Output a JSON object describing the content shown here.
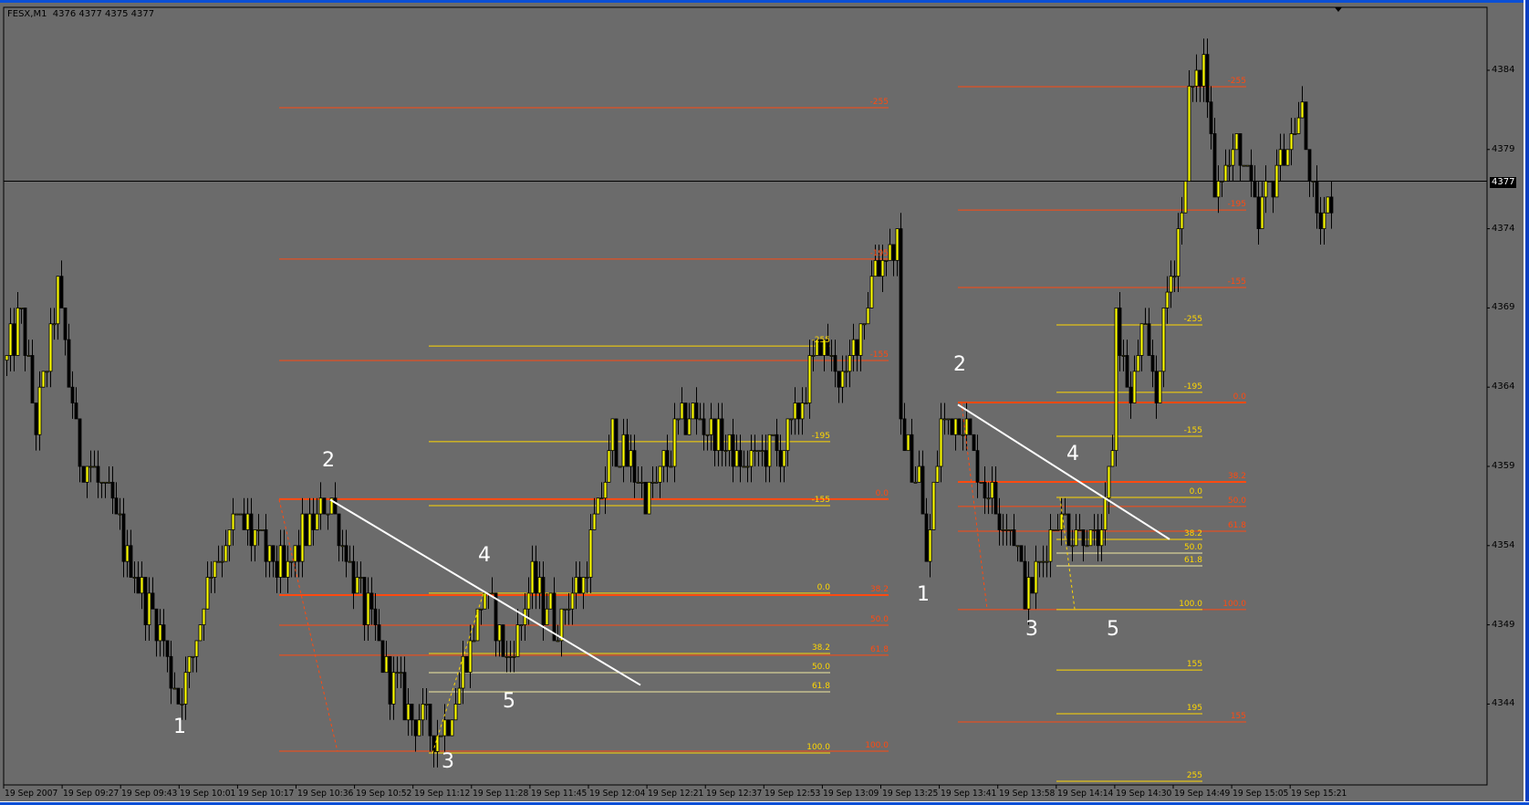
{
  "window": {
    "symbol_line": "FESX,M1  4376 4377 4375 4377"
  },
  "price_axis": {
    "ticks": [
      "4384",
      "4379",
      "4374",
      "4369",
      "4364",
      "4359",
      "4354",
      "4349",
      "4344"
    ],
    "current_price": "4377"
  },
  "time_axis": {
    "ticks": [
      "19 Sep 2007",
      "19 Sep 09:27",
      "19 Sep 09:43",
      "19 Sep 10:01",
      "19 Sep 10:17",
      "19 Sep 10:36",
      "19 Sep 10:52",
      "19 Sep 11:12",
      "19 Sep 11:28",
      "19 Sep 11:45",
      "19 Sep 12:04",
      "19 Sep 12:21",
      "19 Sep 12:37",
      "19 Sep 12:53",
      "19 Sep 13:09",
      "19 Sep 13:25",
      "19 Sep 13:41",
      "19 Sep 13:58",
      "19 Sep 14:14",
      "19 Sep 14:30",
      "19 Sep 14:49",
      "19 Sep 15:05",
      "19 Sep 15:21"
    ]
  },
  "colors": {
    "background": "#6b6b6b",
    "bull": "#ffff00",
    "bear": "#000000",
    "fib_orange": "#ff4a10",
    "fib_yellow": "#ffd700",
    "trend": "#ffffff"
  },
  "wave_labels": [
    "1",
    "2",
    "3",
    "4",
    "5",
    "1",
    "2",
    "3",
    "4",
    "5"
  ],
  "chart_data": {
    "type": "candlestick",
    "title": "FESX,M1",
    "timeframe": "M1",
    "ylim": [
      4338,
      4388
    ],
    "current_price": 4377,
    "approx_path": [
      [
        0,
        4365.7
      ],
      [
        4,
        4368.7
      ],
      [
        8,
        4361.4
      ],
      [
        14,
        4370
      ],
      [
        20,
        4359.5
      ],
      [
        28,
        4357
      ],
      [
        33,
        4353.4
      ],
      [
        42,
        4348.4
      ],
      [
        47,
        4344.1
      ],
      [
        52,
        4348.4
      ],
      [
        56,
        4352.7
      ],
      [
        64,
        4355.8
      ],
      [
        76,
        4352
      ],
      [
        84,
        4355.8
      ],
      [
        89,
        4356.7
      ],
      [
        96,
        4351.5
      ],
      [
        105,
        4345.4
      ],
      [
        117,
        4341.7
      ],
      [
        121,
        4342.9
      ],
      [
        131,
        4350.9
      ],
      [
        137,
        4346.6
      ],
      [
        144,
        4351.5
      ],
      [
        151,
        4349
      ],
      [
        159,
        4352.7
      ],
      [
        166,
        4360.7
      ],
      [
        176,
        4357
      ],
      [
        187,
        4362.6
      ],
      [
        202,
        4358.9
      ],
      [
        214,
        4360.7
      ],
      [
        223,
        4366.9
      ],
      [
        230,
        4364.4
      ],
      [
        238,
        4371.8
      ],
      [
        244,
        4373
      ],
      [
        245,
        4361.4
      ],
      [
        250,
        4358.3
      ],
      [
        252,
        4352.7
      ],
      [
        256,
        4361.4
      ],
      [
        261,
        4362.6
      ],
      [
        268,
        4357.7
      ],
      [
        276,
        4354.6
      ],
      [
        280,
        4350.6
      ],
      [
        287,
        4355.8
      ],
      [
        292,
        4355.2
      ],
      [
        300,
        4354
      ],
      [
        303,
        4360.1
      ],
      [
        304,
        4368.7
      ],
      [
        308,
        4362.6
      ],
      [
        311,
        4367.5
      ],
      [
        315,
        4363.8
      ],
      [
        318,
        4370
      ],
      [
        322,
        4374.9
      ],
      [
        324,
        4381.7
      ],
      [
        328,
        4384.7
      ],
      [
        331,
        4377.4
      ],
      [
        338,
        4379.2
      ],
      [
        343,
        4374.3
      ],
      [
        347,
        4377.4
      ],
      [
        355,
        4381
      ],
      [
        359,
        4373.7
      ],
      [
        363,
        4376.4
      ]
    ],
    "fibonacci": [
      {
        "id": "left-orange",
        "color": "orange",
        "from_bar": 75,
        "to_bar": 242,
        "levels": [
          [
            "-255",
            4381.64
          ],
          [
            "-195",
            4372.08
          ],
          [
            "-155",
            4365.68
          ],
          [
            "0.0",
            4356.93
          ],
          [
            "38.2",
            4350.88
          ],
          [
            "50.0",
            4348.98
          ],
          [
            "61.8",
            4347.08
          ],
          [
            "100.0",
            4341.03
          ]
        ]
      },
      {
        "id": "left-yellow",
        "color": "yellow",
        "from_bar": 116,
        "to_bar": 226,
        "levels": [
          [
            "-255",
            4366.6
          ],
          [
            "-195",
            4360.56
          ],
          [
            "-155",
            4356.52
          ],
          [
            "0.0",
            4351.0
          ],
          [
            "38.2",
            4347.19
          ],
          [
            "50.0",
            4345.98
          ],
          [
            "61.8",
            4344.77
          ],
          [
            "100.0",
            4340.91
          ]
        ]
      },
      {
        "id": "right-orange",
        "color": "orange",
        "from_bar": 261,
        "to_bar": 340,
        "levels": [
          [
            "-255",
            4382.96
          ],
          [
            "-195",
            4375.18
          ],
          [
            "-155",
            4370.29
          ],
          [
            "0.0",
            4363.03
          ],
          [
            "38.2",
            4358.02
          ],
          [
            "50.0",
            4356.47
          ],
          [
            "61.8",
            4354.91
          ],
          [
            "100.0",
            4349.96
          ],
          [
            "155",
            4342.87
          ]
        ]
      },
      {
        "id": "right-yellow",
        "color": "yellow",
        "from_bar": 288,
        "to_bar": 328,
        "levels": [
          [
            "-255",
            4367.93
          ],
          [
            "-195",
            4363.67
          ],
          [
            "-155",
            4360.9
          ],
          [
            "0.0",
            4357.04
          ],
          [
            "38.2",
            4354.39
          ],
          [
            "50.0",
            4353.53
          ],
          [
            "61.8",
            4352.72
          ],
          [
            "100.0",
            4349.96
          ],
          [
            "155",
            4346.15
          ],
          [
            "195",
            4343.39
          ],
          [
            "255",
            4339.13
          ]
        ]
      }
    ],
    "trendlines": [
      {
        "color": "trend",
        "dash": false,
        "p1": [
          89,
          4356.9
        ],
        "p2": [
          174,
          4345.2
        ]
      },
      {
        "color": "trend",
        "dash": false,
        "p1": [
          261,
          4362.9
        ],
        "p2": [
          319,
          4354.4
        ]
      },
      {
        "color": "orange",
        "dash": true,
        "p1": [
          75,
          4356.9
        ],
        "p2": [
          91,
          4341.0
        ]
      },
      {
        "color": "yellow",
        "dash": true,
        "p1": [
          117,
          4340.9
        ],
        "p2": [
          131,
          4351.0
        ]
      },
      {
        "color": "orange",
        "dash": true,
        "p1": [
          262,
          4363.0
        ],
        "p2": [
          269,
          4350.0
        ]
      },
      {
        "color": "yellow",
        "dash": true,
        "p1": [
          289,
          4357.0
        ],
        "p2": [
          293,
          4350.0
        ]
      }
    ]
  }
}
